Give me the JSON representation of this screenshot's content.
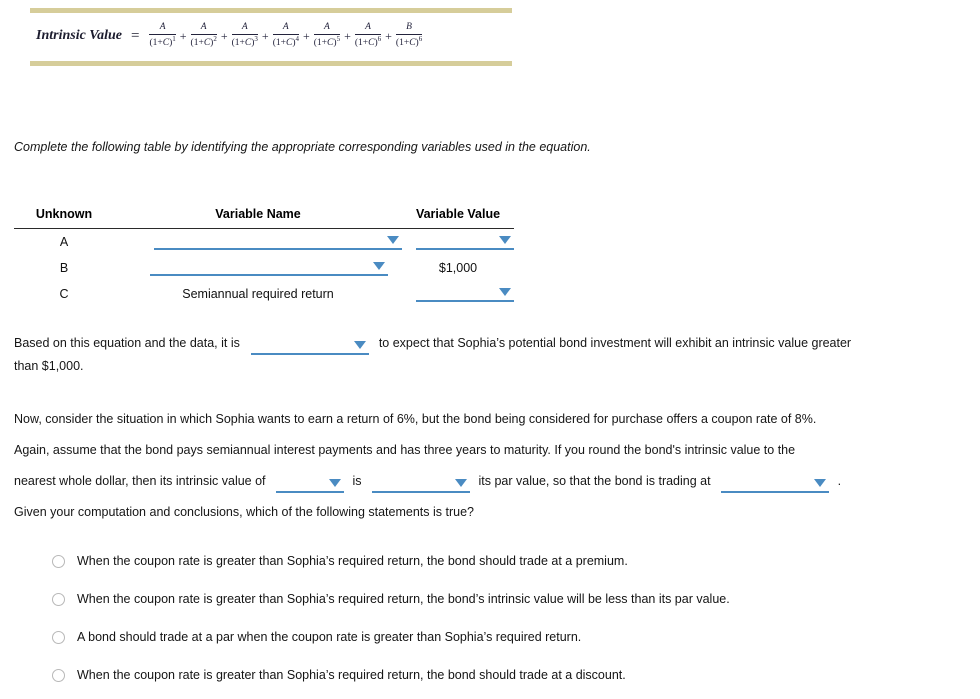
{
  "equation": {
    "label": "Intrinsic Value",
    "equals": "=",
    "terms": [
      {
        "numerator": "A",
        "denominator_base": "(1+C)",
        "exponent": "1"
      },
      {
        "numerator": "A",
        "denominator_base": "(1+C)",
        "exponent": "2"
      },
      {
        "numerator": "A",
        "denominator_base": "(1+C)",
        "exponent": "3"
      },
      {
        "numerator": "A",
        "denominator_base": "(1+C)",
        "exponent": "4"
      },
      {
        "numerator": "A",
        "denominator_base": "(1+C)",
        "exponent": "5"
      },
      {
        "numerator": "A",
        "denominator_base": "(1+C)",
        "exponent": "6"
      },
      {
        "numerator": "B",
        "denominator_base": "(1+C)",
        "exponent": "6"
      }
    ],
    "operator": "+",
    "bar_color": "#d6cd9a"
  },
  "instruction": "Complete the following table by identifying the appropriate corresponding variables used in the equation.",
  "table": {
    "headers": [
      "Unknown",
      "Variable Name",
      "Variable Value"
    ],
    "rows": [
      {
        "unknown": "A",
        "variable_name": "",
        "variable_name_type": "dropdown",
        "variable_value": "",
        "variable_value_type": "dropdown"
      },
      {
        "unknown": "B",
        "variable_name": "",
        "variable_name_type": "dropdown",
        "variable_value": "$1,000",
        "variable_value_type": "text"
      },
      {
        "unknown": "C",
        "variable_name": "Semiannual required return",
        "variable_name_type": "text",
        "variable_value": "",
        "variable_value_type": "dropdown"
      }
    ]
  },
  "para_based": {
    "line1_part1": "Based on this equation and the data, it is",
    "line1_part2": "to expect that Sophia’s potential bond investment will exhibit an intrinsic value greater",
    "line2": "than $1,000.",
    "dropdown_value": ""
  },
  "para_now": {
    "line1": "Now, consider the situation in which Sophia wants to earn a return of 6%, but the bond being considered for purchase offers a coupon rate of 8%.",
    "line2": "Again, assume that the bond pays semiannual interest payments and has three years to maturity. If you round the bond's intrinsic value to the",
    "line3_part1": "nearest whole dollar, then its intrinsic value of",
    "line3_part2": "is",
    "line3_part3": "its par value, so that the bond is trading at",
    "line3_part4": ".",
    "dropdown1_value": "",
    "dropdown2_value": "",
    "dropdown3_value": ""
  },
  "question": "Given your computation and conclusions, which of the following statements is true?",
  "options": [
    "When the coupon rate is greater than Sophia’s required return, the bond should trade at a premium.",
    "When the coupon rate is greater than Sophia’s required return, the bond’s intrinsic value will be less than its par value.",
    "A bond should trade at a par when the coupon rate is greater than Sophia’s required return.",
    "When the coupon rate is greater than Sophia’s required return, the bond should trade at a discount."
  ],
  "selected_option": null,
  "colors": {
    "accent_blue": "#4a8bc2",
    "rule_khaki": "#d6cd9a",
    "text": "#161616"
  }
}
